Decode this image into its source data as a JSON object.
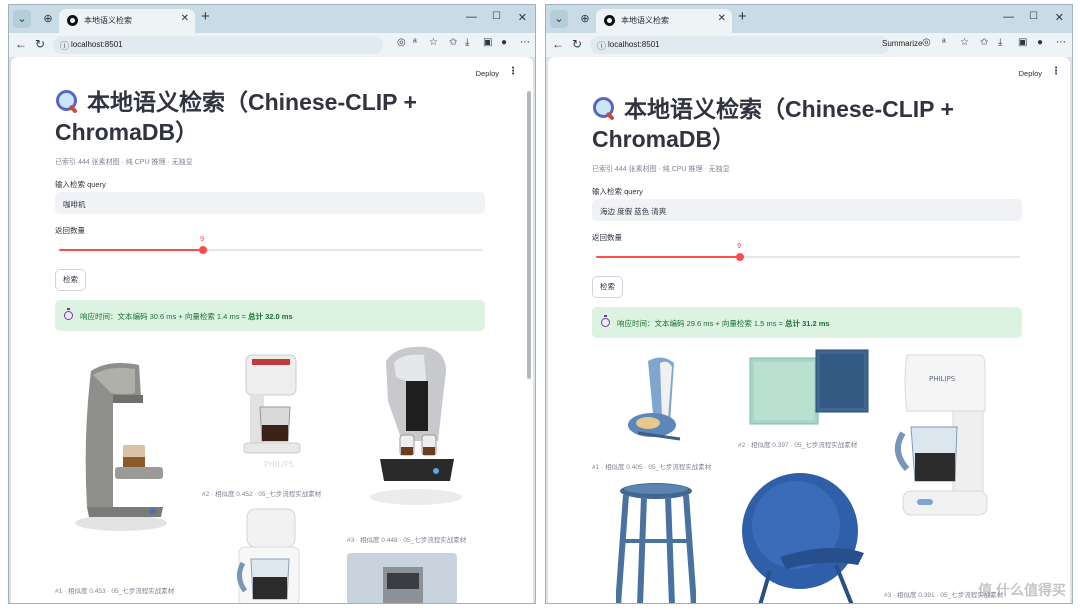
{
  "browser": {
    "tab_title": "本地语义检索",
    "url": "localhost:8501",
    "summarize_label": "Summarize"
  },
  "app": {
    "deploy_label": "Deploy",
    "title_line1": "本地语义检索（Chinese-CLIP +",
    "title_line2": "ChromaDB）",
    "caption": "已索引 444 张素材图 · 纯 CPU 推理 · 无独显",
    "query_label": "输入检索 query",
    "count_label": "返回数量",
    "search_button": "检索"
  },
  "left": {
    "query_value": "咖啡机",
    "slider": {
      "value": "9",
      "fraction": 0.34
    },
    "banner": {
      "prefix": "响应时间：文本编码 ",
      "encode_ms": "30.6",
      "mid": " ms + 向量检索 ",
      "search_ms": "1.4",
      "suffix": " ms = ",
      "total": "总计 32.0 ms"
    },
    "results": [
      {
        "caption": "#1 · 相似度 0.453 · 05_七步流程实战素材"
      },
      {
        "caption": "#2 · 相似度 0.452 · 05_七步流程实战素材"
      },
      {
        "caption": "#3 · 相似度 0.448 · 05_七步流程实战素材"
      }
    ]
  },
  "right": {
    "query_value": "海边 度假 蓝色 清爽",
    "slider": {
      "value": "9",
      "fraction": 0.34
    },
    "banner": {
      "prefix": "响应时间：文本编码 ",
      "encode_ms": "29.6",
      "mid": " ms + 向量检索 ",
      "search_ms": "1.5",
      "suffix": " ms = ",
      "total": "总计 31.2 ms"
    },
    "results": [
      {
        "caption": "#1 · 相似度 0.405 · 05_七步流程实战素材"
      },
      {
        "caption": "#2 · 相似度 0.397 · 05_七步流程实战素材"
      },
      {
        "caption": "#3 · 相似度 0.391 · 05_七步流程实战素材"
      }
    ]
  },
  "watermark": "值 什么值得买",
  "colors": {
    "accent": "#ff4b4b",
    "success_bg": "#ddf3e1",
    "success_text": "#177233"
  }
}
